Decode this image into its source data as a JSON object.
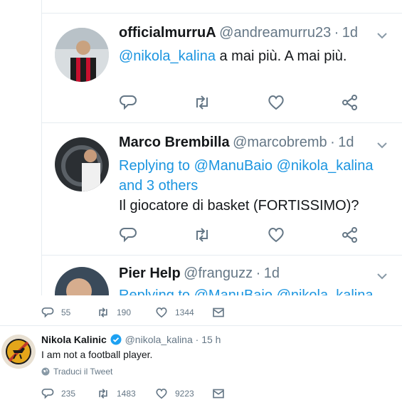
{
  "zoom": {
    "tweets": [
      {
        "display_name": "officialmurruA",
        "handle": "@andreamurru23",
        "time": "1d",
        "mention": "@nikola_kalina",
        "text": "a mai più. A mai più."
      },
      {
        "display_name": "Marco Brembilla",
        "handle": "@marcobremb",
        "time": "1d",
        "replying_prefix": "Replying to",
        "replying_user1": "@ManuBaio",
        "replying_user2": "@nikola_kalina",
        "replying_others": "and 3 others",
        "text": "Il giocatore di basket (FORTISSIMO)?"
      },
      {
        "display_name": "Pier Help",
        "handle": "@franguzz",
        "time": "1d",
        "replying_prefix": "Replying to",
        "replying_user1": "@ManuBaio",
        "replying_user2": "@nikola_kalina"
      }
    ]
  },
  "parent_stats": {
    "replies": "55",
    "retweets": "190",
    "likes": "1344"
  },
  "main_tweet": {
    "display_name": "Nikola Kalinic",
    "handle": "@nikola_kalina",
    "time": "15 h",
    "text": "I am not a football player.",
    "translate": "Traduci il Tweet",
    "replies": "235",
    "retweets": "1483",
    "likes": "9223"
  },
  "colors": {
    "link": "#1b95e0",
    "muted": "#657786",
    "verified": "#1da1f2",
    "border": "#e6ecf0"
  }
}
